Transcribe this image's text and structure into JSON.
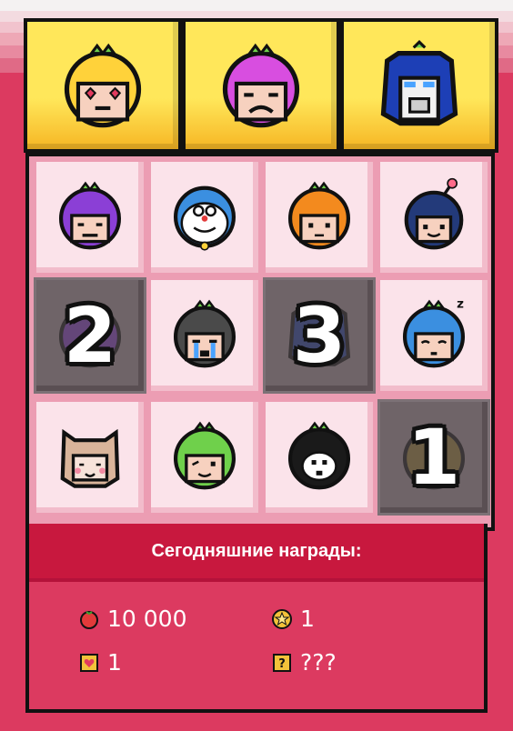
{
  "top_slots": [
    {
      "character": "yellow-helmet-heart-eyes-face"
    },
    {
      "character": "purple-helmet-grumpy-face"
    },
    {
      "character": "robot-blue-helmet-face"
    }
  ],
  "board": {
    "cells": [
      {
        "character": "purple-helmet-face",
        "number": ""
      },
      {
        "character": "blue-cat-robot-face",
        "number": ""
      },
      {
        "character": "orange-helmet-face",
        "number": ""
      },
      {
        "character": "bomb-navy-face",
        "number": ""
      },
      {
        "character": "purple-shadow-face",
        "number": "2"
      },
      {
        "character": "dark-helmet-crying-face",
        "number": ""
      },
      {
        "character": "robot-shadow-face",
        "number": "3"
      },
      {
        "character": "blue-helmet-sleeping-face",
        "number": ""
      },
      {
        "character": "cat-ears-beige-face",
        "number": ""
      },
      {
        "character": "green-helmet-face",
        "number": ""
      },
      {
        "character": "black-helmet-white-face",
        "number": ""
      },
      {
        "character": "olive-shadow-face",
        "number": "1"
      }
    ]
  },
  "rewards": {
    "title": "Сегодняшние награды:",
    "items": [
      {
        "icon": "tomato-coin-icon",
        "value": "10 000"
      },
      {
        "icon": "star-coin-icon",
        "value": "1"
      },
      {
        "icon": "heart-card-icon",
        "value": "1"
      },
      {
        "icon": "mystery-box-icon",
        "value": "???"
      }
    ]
  },
  "colors": {
    "background": "#dc3a60",
    "header": "#c8183e",
    "slot_yellow": "#ffe75a",
    "cell_light": "#fbe3ea",
    "cell_dark": "#6f6468"
  }
}
